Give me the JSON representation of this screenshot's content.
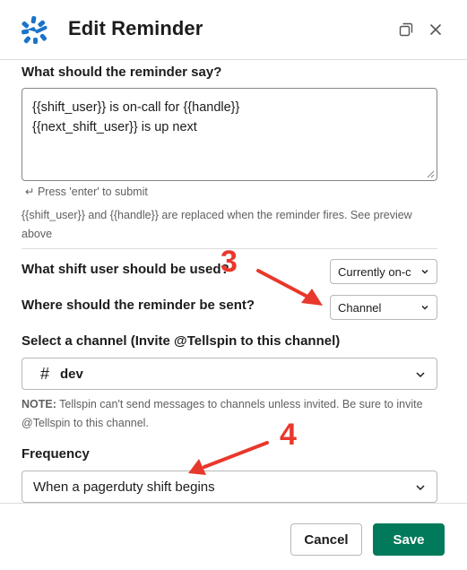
{
  "header": {
    "title": "Edit Reminder",
    "app_icon": "tellspin-logo-icon",
    "expand_icon": "expand-window-icon",
    "close_icon": "close-icon"
  },
  "message": {
    "label": "What should the reminder say?",
    "lines": [
      "{{shift_user}} is on-call for {{handle}}",
      "{{next_shift_user}} is up next"
    ],
    "hint": "↵ Press 'enter' to submit",
    "help": "{{shift_user}} and {{handle}} are replaced when the reminder fires. See preview above"
  },
  "shift_user": {
    "label": "What shift user should be used?",
    "selected": "Currently on-c"
  },
  "destination": {
    "label": "Where should the reminder be sent?",
    "selected": "Channel"
  },
  "channel": {
    "label": "Select a channel (Invite @Tellspin to this channel)",
    "hash": "#",
    "selected": "dev",
    "note_bold": "NOTE:",
    "note_text": " Tellspin can't send messages to channels unless invited. Be sure to invite @Tellspin to this channel."
  },
  "frequency": {
    "label": "Frequency",
    "selected": "When a pagerduty shift begins"
  },
  "annotations": {
    "step_3": "3",
    "step_4": "4",
    "color": "#e8382b"
  },
  "footer": {
    "cancel_label": "Cancel",
    "save_label": "Save",
    "save_color": "#007a5a"
  }
}
